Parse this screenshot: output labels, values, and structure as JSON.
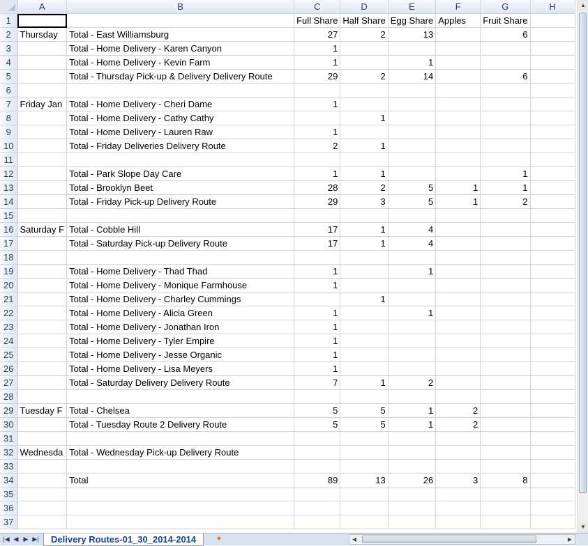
{
  "columns": [
    "A",
    "B",
    "C",
    "D",
    "E",
    "F",
    "G",
    "H"
  ],
  "rows": [
    {
      "n": "1",
      "a": "",
      "b": "",
      "c": "Full Share",
      "d": "Half Share",
      "e": "Egg Share",
      "f": "Apples",
      "g": "Fruit Share",
      "h": ""
    },
    {
      "n": "2",
      "a": "Thursday ",
      "b": "Total - East Williamsburg",
      "c": "27",
      "d": "2",
      "e": "13",
      "f": "",
      "g": "6",
      "h": ""
    },
    {
      "n": "3",
      "a": "",
      "b": "Total - Home Delivery - Karen Canyon",
      "c": "1",
      "d": "",
      "e": "",
      "f": "",
      "g": "",
      "h": ""
    },
    {
      "n": "4",
      "a": "",
      "b": "Total - Home Delivery - Kevin Farm",
      "c": "1",
      "d": "",
      "e": "1",
      "f": "",
      "g": "",
      "h": ""
    },
    {
      "n": "5",
      "a": "",
      "b": "Total - Thursday Pick-up & Delivery Delivery Route",
      "c": "29",
      "d": "2",
      "e": "14",
      "f": "",
      "g": "6",
      "h": ""
    },
    {
      "n": "6",
      "a": "",
      "b": "",
      "c": "",
      "d": "",
      "e": "",
      "f": "",
      "g": "",
      "h": ""
    },
    {
      "n": "7",
      "a": "Friday Jan",
      "b": "Total - Home Delivery - Cheri Dame",
      "c": "1",
      "d": "",
      "e": "",
      "f": "",
      "g": "",
      "h": ""
    },
    {
      "n": "8",
      "a": "",
      "b": "Total - Home Delivery - Cathy Cathy",
      "c": "",
      "d": "1",
      "e": "",
      "f": "",
      "g": "",
      "h": ""
    },
    {
      "n": "9",
      "a": "",
      "b": "Total - Home Delivery - Lauren Raw",
      "c": "1",
      "d": "",
      "e": "",
      "f": "",
      "g": "",
      "h": ""
    },
    {
      "n": "10",
      "a": "",
      "b": "Total - Friday Deliveries Delivery Route",
      "c": "2",
      "d": "1",
      "e": "",
      "f": "",
      "g": "",
      "h": ""
    },
    {
      "n": "11",
      "a": "",
      "b": "",
      "c": "",
      "d": "",
      "e": "",
      "f": "",
      "g": "",
      "h": ""
    },
    {
      "n": "12",
      "a": "",
      "b": "Total - Park Slope Day Care",
      "c": "1",
      "d": "1",
      "e": "",
      "f": "",
      "g": "1",
      "h": ""
    },
    {
      "n": "13",
      "a": "",
      "b": "Total - Brooklyn Beet",
      "c": "28",
      "d": "2",
      "e": "5",
      "f": "1",
      "g": "1",
      "h": ""
    },
    {
      "n": "14",
      "a": "",
      "b": "Total - Friday Pick-up Delivery Route",
      "c": "29",
      "d": "3",
      "e": "5",
      "f": "1",
      "g": "2",
      "h": ""
    },
    {
      "n": "15",
      "a": "",
      "b": "",
      "c": "",
      "d": "",
      "e": "",
      "f": "",
      "g": "",
      "h": ""
    },
    {
      "n": "16",
      "a": "Saturday F",
      "b": "Total - Cobble Hill",
      "c": "17",
      "d": "1",
      "e": "4",
      "f": "",
      "g": "",
      "h": ""
    },
    {
      "n": "17",
      "a": "",
      "b": "Total - Saturday Pick-up Delivery Route",
      "c": "17",
      "d": "1",
      "e": "4",
      "f": "",
      "g": "",
      "h": ""
    },
    {
      "n": "18",
      "a": "",
      "b": "",
      "c": "",
      "d": "",
      "e": "",
      "f": "",
      "g": "",
      "h": ""
    },
    {
      "n": "19",
      "a": "",
      "b": "Total - Home Delivery - Thad Thad",
      "c": "1",
      "d": "",
      "e": "1",
      "f": "",
      "g": "",
      "h": ""
    },
    {
      "n": "20",
      "a": "",
      "b": "Total - Home Delivery - Monique Farmhouse",
      "c": "1",
      "d": "",
      "e": "",
      "f": "",
      "g": "",
      "h": ""
    },
    {
      "n": "21",
      "a": "",
      "b": "Total - Home Delivery - Charley Cummings",
      "c": "",
      "d": "1",
      "e": "",
      "f": "",
      "g": "",
      "h": ""
    },
    {
      "n": "22",
      "a": "",
      "b": "Total - Home Delivery - Alicia Green",
      "c": "1",
      "d": "",
      "e": "1",
      "f": "",
      "g": "",
      "h": ""
    },
    {
      "n": "23",
      "a": "",
      "b": "Total - Home Delivery - Jonathan Iron",
      "c": "1",
      "d": "",
      "e": "",
      "f": "",
      "g": "",
      "h": ""
    },
    {
      "n": "24",
      "a": "",
      "b": "Total - Home Delivery - Tyler Empire",
      "c": "1",
      "d": "",
      "e": "",
      "f": "",
      "g": "",
      "h": ""
    },
    {
      "n": "25",
      "a": "",
      "b": "Total - Home Delivery - Jesse Organic",
      "c": "1",
      "d": "",
      "e": "",
      "f": "",
      "g": "",
      "h": ""
    },
    {
      "n": "26",
      "a": "",
      "b": "Total - Home Delivery - Lisa Meyers",
      "c": "1",
      "d": "",
      "e": "",
      "f": "",
      "g": "",
      "h": ""
    },
    {
      "n": "27",
      "a": "",
      "b": "Total - Saturday Delivery Delivery Route",
      "c": "7",
      "d": "1",
      "e": "2",
      "f": "",
      "g": "",
      "h": ""
    },
    {
      "n": "28",
      "a": "",
      "b": "",
      "c": "",
      "d": "",
      "e": "",
      "f": "",
      "g": "",
      "h": ""
    },
    {
      "n": "29",
      "a": "Tuesday F",
      "b": "Total - Chelsea",
      "c": "5",
      "d": "5",
      "e": "1",
      "f": "2",
      "g": "",
      "h": ""
    },
    {
      "n": "30",
      "a": "",
      "b": "Total - Tuesday Route 2 Delivery Route",
      "c": "5",
      "d": "5",
      "e": "1",
      "f": "2",
      "g": "",
      "h": ""
    },
    {
      "n": "31",
      "a": "",
      "b": "",
      "c": "",
      "d": "",
      "e": "",
      "f": "",
      "g": "",
      "h": ""
    },
    {
      "n": "32",
      "a": "Wednesda",
      "b": "Total - Wednesday Pick-up Delivery Route",
      "c": "",
      "d": "",
      "e": "",
      "f": "",
      "g": "",
      "h": ""
    },
    {
      "n": "33",
      "a": "",
      "b": "",
      "c": "",
      "d": "",
      "e": "",
      "f": "",
      "g": "",
      "h": ""
    },
    {
      "n": "34",
      "a": "",
      "b": "Total",
      "c": "89",
      "d": "13",
      "e": "26",
      "f": "3",
      "g": "8",
      "h": ""
    },
    {
      "n": "35",
      "a": "",
      "b": "",
      "c": "",
      "d": "",
      "e": "",
      "f": "",
      "g": "",
      "h": ""
    },
    {
      "n": "36",
      "a": "",
      "b": "",
      "c": "",
      "d": "",
      "e": "",
      "f": "",
      "g": "",
      "h": ""
    },
    {
      "n": "37",
      "a": "",
      "b": "",
      "c": "",
      "d": "",
      "e": "",
      "f": "",
      "g": "",
      "h": ""
    }
  ],
  "sheet_tab": "Delivery Routes-01_30_2014-2014",
  "icons": {
    "nav_first": "first-sheet-icon",
    "nav_prev": "prev-sheet-icon",
    "nav_next": "next-sheet-icon",
    "nav_last": "last-sheet-icon",
    "insert_sheet": "insert-sheet-icon"
  }
}
